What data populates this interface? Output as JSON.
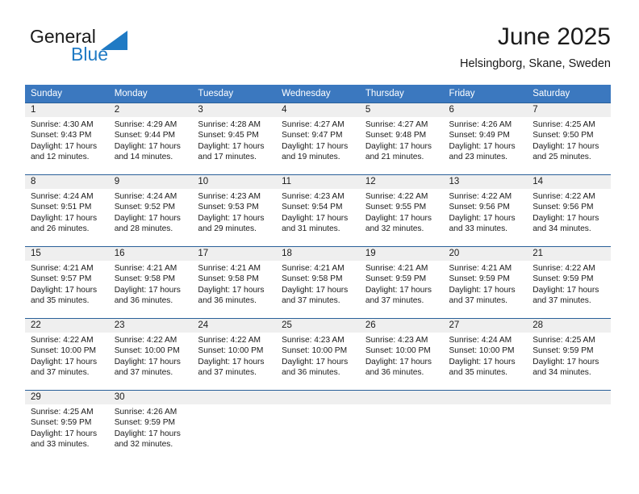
{
  "brand": {
    "name_part1": "General",
    "name_part2": "Blue",
    "logo_icon": "triangle-icon"
  },
  "header": {
    "title": "June 2025",
    "location": "Helsingborg, Skane, Sweden"
  },
  "theme": {
    "header_blue": "#3b78bf",
    "border_blue": "#2a6099",
    "daynum_gray": "#efefef",
    "brand_blue": "#1f7ac4",
    "text": "#1a1a1a"
  },
  "weekdays": [
    "Sunday",
    "Monday",
    "Tuesday",
    "Wednesday",
    "Thursday",
    "Friday",
    "Saturday"
  ],
  "weeks": [
    [
      {
        "day": "1",
        "sunrise": "Sunrise: 4:30 AM",
        "sunset": "Sunset: 9:43 PM",
        "daylight": "Daylight: 17 hours and 12 minutes."
      },
      {
        "day": "2",
        "sunrise": "Sunrise: 4:29 AM",
        "sunset": "Sunset: 9:44 PM",
        "daylight": "Daylight: 17 hours and 14 minutes."
      },
      {
        "day": "3",
        "sunrise": "Sunrise: 4:28 AM",
        "sunset": "Sunset: 9:45 PM",
        "daylight": "Daylight: 17 hours and 17 minutes."
      },
      {
        "day": "4",
        "sunrise": "Sunrise: 4:27 AM",
        "sunset": "Sunset: 9:47 PM",
        "daylight": "Daylight: 17 hours and 19 minutes."
      },
      {
        "day": "5",
        "sunrise": "Sunrise: 4:27 AM",
        "sunset": "Sunset: 9:48 PM",
        "daylight": "Daylight: 17 hours and 21 minutes."
      },
      {
        "day": "6",
        "sunrise": "Sunrise: 4:26 AM",
        "sunset": "Sunset: 9:49 PM",
        "daylight": "Daylight: 17 hours and 23 minutes."
      },
      {
        "day": "7",
        "sunrise": "Sunrise: 4:25 AM",
        "sunset": "Sunset: 9:50 PM",
        "daylight": "Daylight: 17 hours and 25 minutes."
      }
    ],
    [
      {
        "day": "8",
        "sunrise": "Sunrise: 4:24 AM",
        "sunset": "Sunset: 9:51 PM",
        "daylight": "Daylight: 17 hours and 26 minutes."
      },
      {
        "day": "9",
        "sunrise": "Sunrise: 4:24 AM",
        "sunset": "Sunset: 9:52 PM",
        "daylight": "Daylight: 17 hours and 28 minutes."
      },
      {
        "day": "10",
        "sunrise": "Sunrise: 4:23 AM",
        "sunset": "Sunset: 9:53 PM",
        "daylight": "Daylight: 17 hours and 29 minutes."
      },
      {
        "day": "11",
        "sunrise": "Sunrise: 4:23 AM",
        "sunset": "Sunset: 9:54 PM",
        "daylight": "Daylight: 17 hours and 31 minutes."
      },
      {
        "day": "12",
        "sunrise": "Sunrise: 4:22 AM",
        "sunset": "Sunset: 9:55 PM",
        "daylight": "Daylight: 17 hours and 32 minutes."
      },
      {
        "day": "13",
        "sunrise": "Sunrise: 4:22 AM",
        "sunset": "Sunset: 9:56 PM",
        "daylight": "Daylight: 17 hours and 33 minutes."
      },
      {
        "day": "14",
        "sunrise": "Sunrise: 4:22 AM",
        "sunset": "Sunset: 9:56 PM",
        "daylight": "Daylight: 17 hours and 34 minutes."
      }
    ],
    [
      {
        "day": "15",
        "sunrise": "Sunrise: 4:21 AM",
        "sunset": "Sunset: 9:57 PM",
        "daylight": "Daylight: 17 hours and 35 minutes."
      },
      {
        "day": "16",
        "sunrise": "Sunrise: 4:21 AM",
        "sunset": "Sunset: 9:58 PM",
        "daylight": "Daylight: 17 hours and 36 minutes."
      },
      {
        "day": "17",
        "sunrise": "Sunrise: 4:21 AM",
        "sunset": "Sunset: 9:58 PM",
        "daylight": "Daylight: 17 hours and 36 minutes."
      },
      {
        "day": "18",
        "sunrise": "Sunrise: 4:21 AM",
        "sunset": "Sunset: 9:58 PM",
        "daylight": "Daylight: 17 hours and 37 minutes."
      },
      {
        "day": "19",
        "sunrise": "Sunrise: 4:21 AM",
        "sunset": "Sunset: 9:59 PM",
        "daylight": "Daylight: 17 hours and 37 minutes."
      },
      {
        "day": "20",
        "sunrise": "Sunrise: 4:21 AM",
        "sunset": "Sunset: 9:59 PM",
        "daylight": "Daylight: 17 hours and 37 minutes."
      },
      {
        "day": "21",
        "sunrise": "Sunrise: 4:22 AM",
        "sunset": "Sunset: 9:59 PM",
        "daylight": "Daylight: 17 hours and 37 minutes."
      }
    ],
    [
      {
        "day": "22",
        "sunrise": "Sunrise: 4:22 AM",
        "sunset": "Sunset: 10:00 PM",
        "daylight": "Daylight: 17 hours and 37 minutes."
      },
      {
        "day": "23",
        "sunrise": "Sunrise: 4:22 AM",
        "sunset": "Sunset: 10:00 PM",
        "daylight": "Daylight: 17 hours and 37 minutes."
      },
      {
        "day": "24",
        "sunrise": "Sunrise: 4:22 AM",
        "sunset": "Sunset: 10:00 PM",
        "daylight": "Daylight: 17 hours and 37 minutes."
      },
      {
        "day": "25",
        "sunrise": "Sunrise: 4:23 AM",
        "sunset": "Sunset: 10:00 PM",
        "daylight": "Daylight: 17 hours and 36 minutes."
      },
      {
        "day": "26",
        "sunrise": "Sunrise: 4:23 AM",
        "sunset": "Sunset: 10:00 PM",
        "daylight": "Daylight: 17 hours and 36 minutes."
      },
      {
        "day": "27",
        "sunrise": "Sunrise: 4:24 AM",
        "sunset": "Sunset: 10:00 PM",
        "daylight": "Daylight: 17 hours and 35 minutes."
      },
      {
        "day": "28",
        "sunrise": "Sunrise: 4:25 AM",
        "sunset": "Sunset: 9:59 PM",
        "daylight": "Daylight: 17 hours and 34 minutes."
      }
    ],
    [
      {
        "day": "29",
        "sunrise": "Sunrise: 4:25 AM",
        "sunset": "Sunset: 9:59 PM",
        "daylight": "Daylight: 17 hours and 33 minutes."
      },
      {
        "day": "30",
        "sunrise": "Sunrise: 4:26 AM",
        "sunset": "Sunset: 9:59 PM",
        "daylight": "Daylight: 17 hours and 32 minutes."
      },
      {
        "day": "",
        "sunrise": "",
        "sunset": "",
        "daylight": ""
      },
      {
        "day": "",
        "sunrise": "",
        "sunset": "",
        "daylight": ""
      },
      {
        "day": "",
        "sunrise": "",
        "sunset": "",
        "daylight": ""
      },
      {
        "day": "",
        "sunrise": "",
        "sunset": "",
        "daylight": ""
      },
      {
        "day": "",
        "sunrise": "",
        "sunset": "",
        "daylight": ""
      }
    ]
  ]
}
